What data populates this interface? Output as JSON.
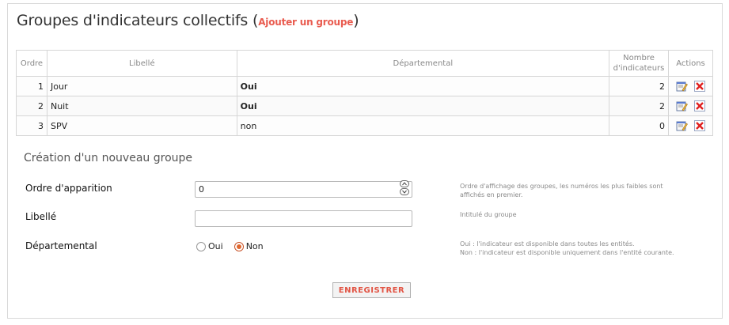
{
  "header": {
    "title": "Groupes d'indicateurs collectifs",
    "open_paren": "(",
    "add_link": "Ajouter un groupe",
    "close_paren": ")"
  },
  "table": {
    "headers": {
      "order": "Ordre",
      "label": "Libellé",
      "departmental": "Départemental",
      "count_line1": "Nombre",
      "count_line2": "d'indicateurs",
      "actions": "Actions"
    },
    "rows": [
      {
        "order": "1",
        "label": "Jour",
        "departmental": "Oui",
        "count": "2"
      },
      {
        "order": "2",
        "label": "Nuit",
        "departmental": "Oui",
        "count": "2"
      },
      {
        "order": "3",
        "label": "SPV",
        "departmental": "non",
        "count": "0"
      }
    ]
  },
  "form": {
    "title": "Création d'un nouveau groupe",
    "order": {
      "label": "Ordre d'apparition",
      "value": "0",
      "help_line1": "Ordre d'affichage des groupes, les numéros les plus faibles sont",
      "help_line2": "affichés en premier."
    },
    "name": {
      "label": "Libellé",
      "value": "",
      "help": "Intitulé du groupe"
    },
    "departmental": {
      "label": "Départemental",
      "option_yes": "Oui",
      "option_no": "Non",
      "selected": "Non",
      "help_line1": "Oui : l'indicateur est disponible dans toutes les entités.",
      "help_line2": "Non : l'indicateur est disponible uniquement dans l'entité courante."
    },
    "submit_label": "ENREGISTRER"
  },
  "colors": {
    "accent": "#e95b4f",
    "radio_checked": "#e1682f",
    "border": "#d6d6d6"
  },
  "icons": {
    "edit": "edit-icon",
    "delete": "delete-icon",
    "spinner_up": "chevron-up-icon",
    "spinner_down": "chevron-down-icon"
  }
}
